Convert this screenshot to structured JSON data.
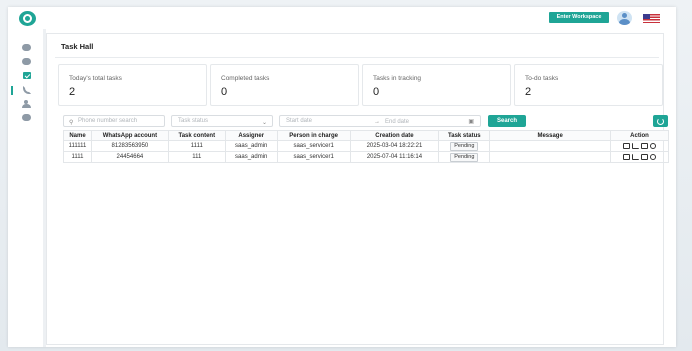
{
  "header": {
    "enter_workspace_label": "Enter Workspace",
    "logo_icon": "app-logo-icon",
    "avatar_icon": "user-avatar-icon",
    "language_flag": "us-flag-icon"
  },
  "sidebar": {
    "items": [
      {
        "icon": "chat-bubble-icon"
      },
      {
        "icon": "message-icon"
      },
      {
        "icon": "task-icon",
        "active": true
      },
      {
        "icon": "phone-icon"
      },
      {
        "icon": "users-icon"
      },
      {
        "icon": "more-icon"
      }
    ]
  },
  "page": {
    "title": "Task Hall"
  },
  "stats": [
    {
      "label": "Today's total tasks",
      "value": "2"
    },
    {
      "label": "Completed tasks",
      "value": "0"
    },
    {
      "label": "Tasks in tracking",
      "value": "0"
    },
    {
      "label": "To-do tasks",
      "value": "2"
    }
  ],
  "filters": {
    "phone_placeholder": "Phone number search",
    "status_placeholder": "Task status",
    "start_placeholder": "Start date",
    "range_separator": "→",
    "end_placeholder": "End date",
    "search_label": "Search"
  },
  "table": {
    "columns": [
      "Name",
      "WhatsApp account",
      "Task content",
      "Assigner",
      "Person in charge",
      "Creation date",
      "Task status",
      "Message",
      "Action"
    ],
    "rows": [
      {
        "name": "111111",
        "account": "81283563950",
        "content": "1111",
        "assigner": "saas_admin",
        "person": "saas_servicer1",
        "created": "2025-03-04 18:22:21",
        "status": "Pending",
        "message": ""
      },
      {
        "name": "1111",
        "account": "24454664",
        "content": "111",
        "assigner": "saas_admin",
        "person": "saas_servicer1",
        "created": "2025-07-04 11:16:14",
        "status": "Pending",
        "message": ""
      }
    ]
  },
  "colors": {
    "accent": "#1fa596"
  }
}
